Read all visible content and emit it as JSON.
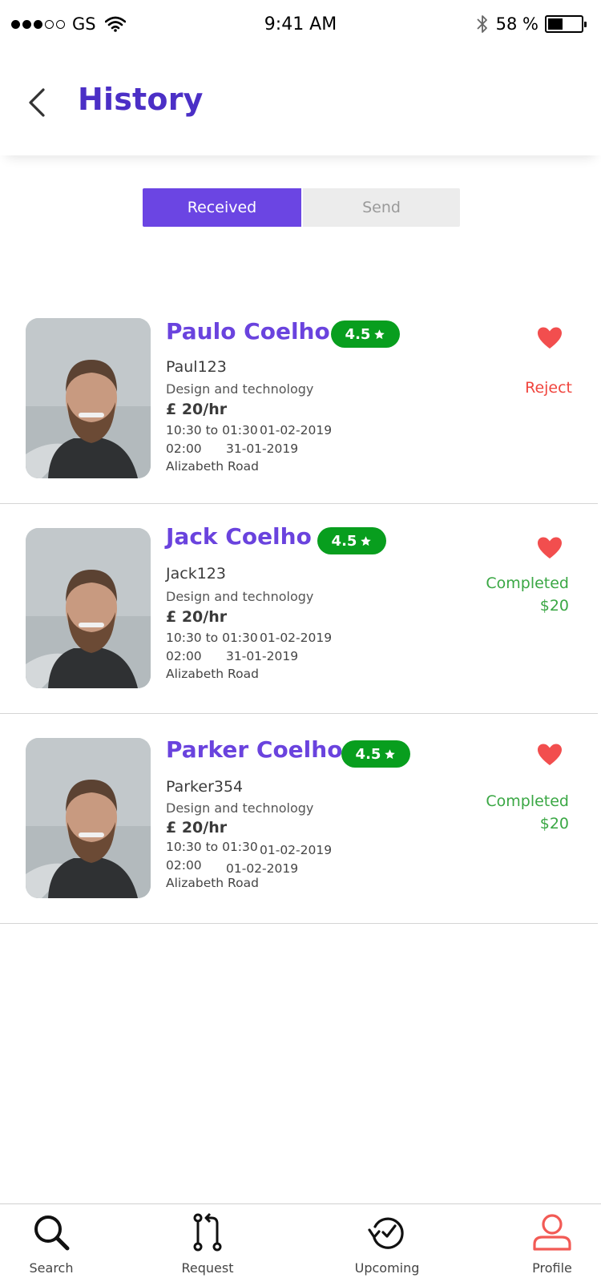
{
  "status_bar": {
    "carrier": "GS",
    "time": "9:41 AM",
    "battery": "58 %"
  },
  "header": {
    "title": "History"
  },
  "tabs": {
    "received": "Received",
    "send": "Send",
    "active": "Received"
  },
  "accent_colors": {
    "primary": "#6b45e3",
    "title": "#4b2fc6",
    "rating": "#089e1e",
    "reject": "#f0453e",
    "completed": "#3aa744",
    "heart": "#f24e4e"
  },
  "history": [
    {
      "name": "Paulo Coelho",
      "rating": "4.5",
      "username": "Paul123",
      "category": "Design and technology",
      "rate": "£ 20/hr",
      "time_range": "10:30 to 01:30",
      "date1": "01-02-2019",
      "duration": "02:00",
      "date2": "31-01-2019",
      "location": "Alizabeth Road",
      "status": "Reject",
      "amount": ""
    },
    {
      "name": "Jack Coelho",
      "rating": "4.5",
      "username": "Jack123",
      "category": "Design and technology",
      "rate": "£ 20/hr",
      "time_range": "10:30 to 01:30",
      "date1": "01-02-2019",
      "duration": "02:00",
      "date2": "31-01-2019",
      "location": "Alizabeth Road",
      "status": "Completed",
      "amount": "$20"
    },
    {
      "name": "Parker Coelho",
      "rating": "4.5",
      "username": "Parker354",
      "category": "Design and technology",
      "rate": "£ 20/hr",
      "time_range": "10:30 to 01:30",
      "date1": "01-02-2019",
      "duration": "02:00",
      "date2": "01-02-2019",
      "location": "Alizabeth Road",
      "status": "Completed",
      "amount": "$20"
    }
  ],
  "bottom_nav": [
    {
      "label": "Search",
      "icon": "search-icon"
    },
    {
      "label": "Request",
      "icon": "request-icon"
    },
    {
      "label": "Upcoming",
      "icon": "upcoming-icon"
    },
    {
      "label": "Profile",
      "icon": "profile-icon"
    }
  ]
}
